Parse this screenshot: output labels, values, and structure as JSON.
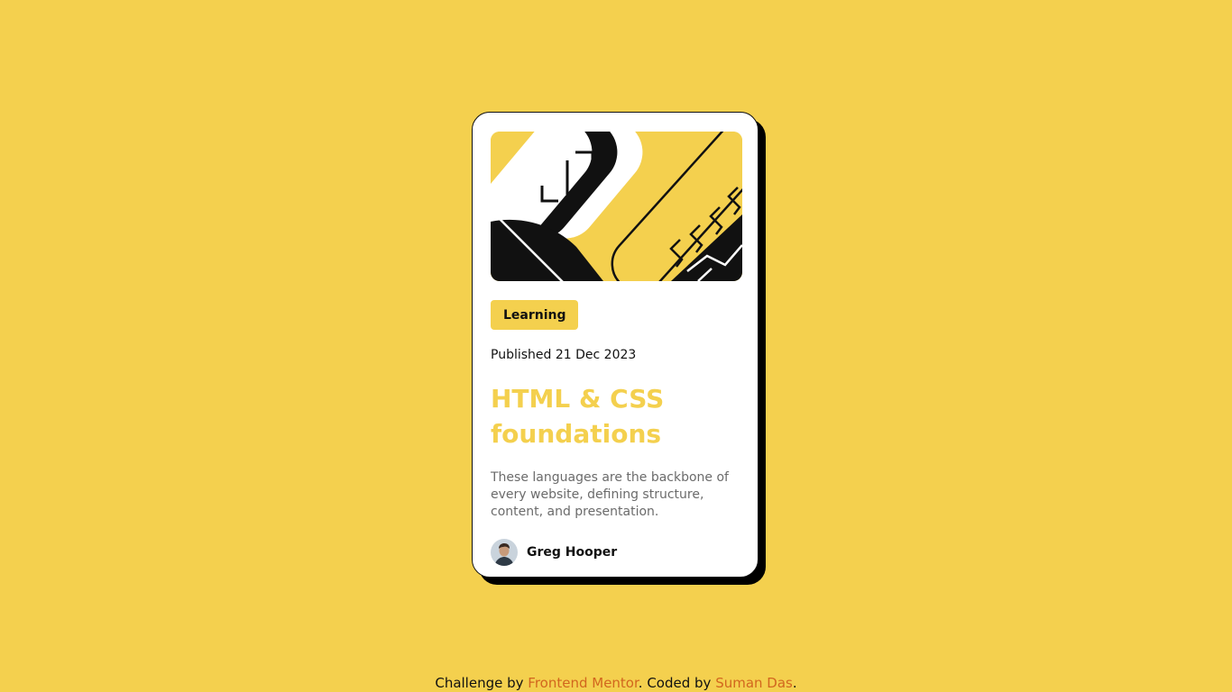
{
  "card": {
    "tag": "Learning",
    "published": "Published 21 Dec 2023",
    "title": "HTML & CSS foundations",
    "description": "These languages are the backbone of every website, defining structure, content, and presentation.",
    "author": "Greg Hooper"
  },
  "attribution": {
    "prefix": "Challenge by ",
    "frontend_mentor": "Frontend Mentor",
    "middle": ". Coded by ",
    "coder": "Suman Das",
    "suffix": "."
  },
  "colors": {
    "background": "#F4D04E",
    "card": "#FFFFFF",
    "title": "#F4D04E",
    "link": "#D2661E",
    "text": "#111111",
    "muted": "#6B6B6B"
  }
}
